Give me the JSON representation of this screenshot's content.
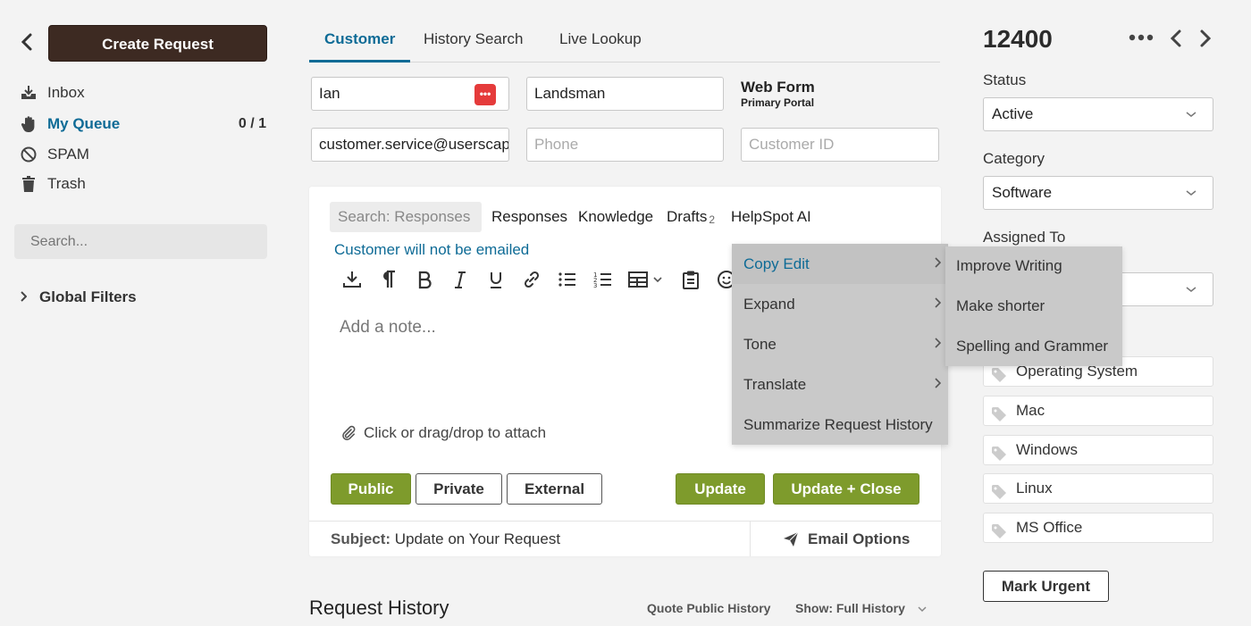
{
  "sidebar": {
    "create_label": "Create Request",
    "nav": [
      {
        "label": "Inbox",
        "count": ""
      },
      {
        "label": "My Queue",
        "count": "0 / 1"
      },
      {
        "label": "SPAM",
        "count": ""
      },
      {
        "label": "Trash",
        "count": ""
      }
    ],
    "search_placeholder": "Search...",
    "global_filters": "Global Filters"
  },
  "tabs": [
    "Customer",
    "History Search",
    "Live Lookup"
  ],
  "customer": {
    "first_name": "Ian",
    "last_name": "Landsman",
    "email": "customer.service@userscape.com",
    "phone_placeholder": "Phone",
    "customer_id_placeholder": "Customer ID",
    "source": "Web Form",
    "source_sub": "Primary Portal"
  },
  "editor": {
    "search_responses": "Search: Responses",
    "links": [
      "Responses",
      "Knowledge",
      "Drafts",
      "HelpSpot AI"
    ],
    "drafts_count": "2",
    "email_note": "Customer will not be emailed",
    "note_placeholder": "Add a note...",
    "attach": "Click or drag/drop to attach",
    "buttons": {
      "public": "Public",
      "private": "Private",
      "external": "External",
      "update": "Update",
      "update_close": "Update + Close"
    },
    "subject_label": "Subject:",
    "subject": "Update on Your Request",
    "email_options": "Email Options"
  },
  "history": {
    "title": "Request History",
    "quote": "Quote Public History",
    "show": "Show: Full History"
  },
  "request": {
    "id": "12400",
    "status_label": "Status",
    "status": "Active",
    "category_label": "Category",
    "category": "Software",
    "assigned_label": "Assigned To",
    "tags": [
      "Operating System",
      "Mac",
      "Windows",
      "Linux",
      "MS Office"
    ],
    "mark_urgent": "Mark Urgent"
  },
  "menu": {
    "items": [
      "Copy Edit",
      "Expand",
      "Tone",
      "Translate",
      "Summarize Request History"
    ],
    "submenu": [
      "Improve Writing",
      "Make shorter",
      "Spelling and Grammer"
    ]
  },
  "colors": {
    "accent": "#0e6b96",
    "create_button": "#3d2a22",
    "green_button": "#7e9b2c",
    "password_badge": "#e53b3b"
  }
}
